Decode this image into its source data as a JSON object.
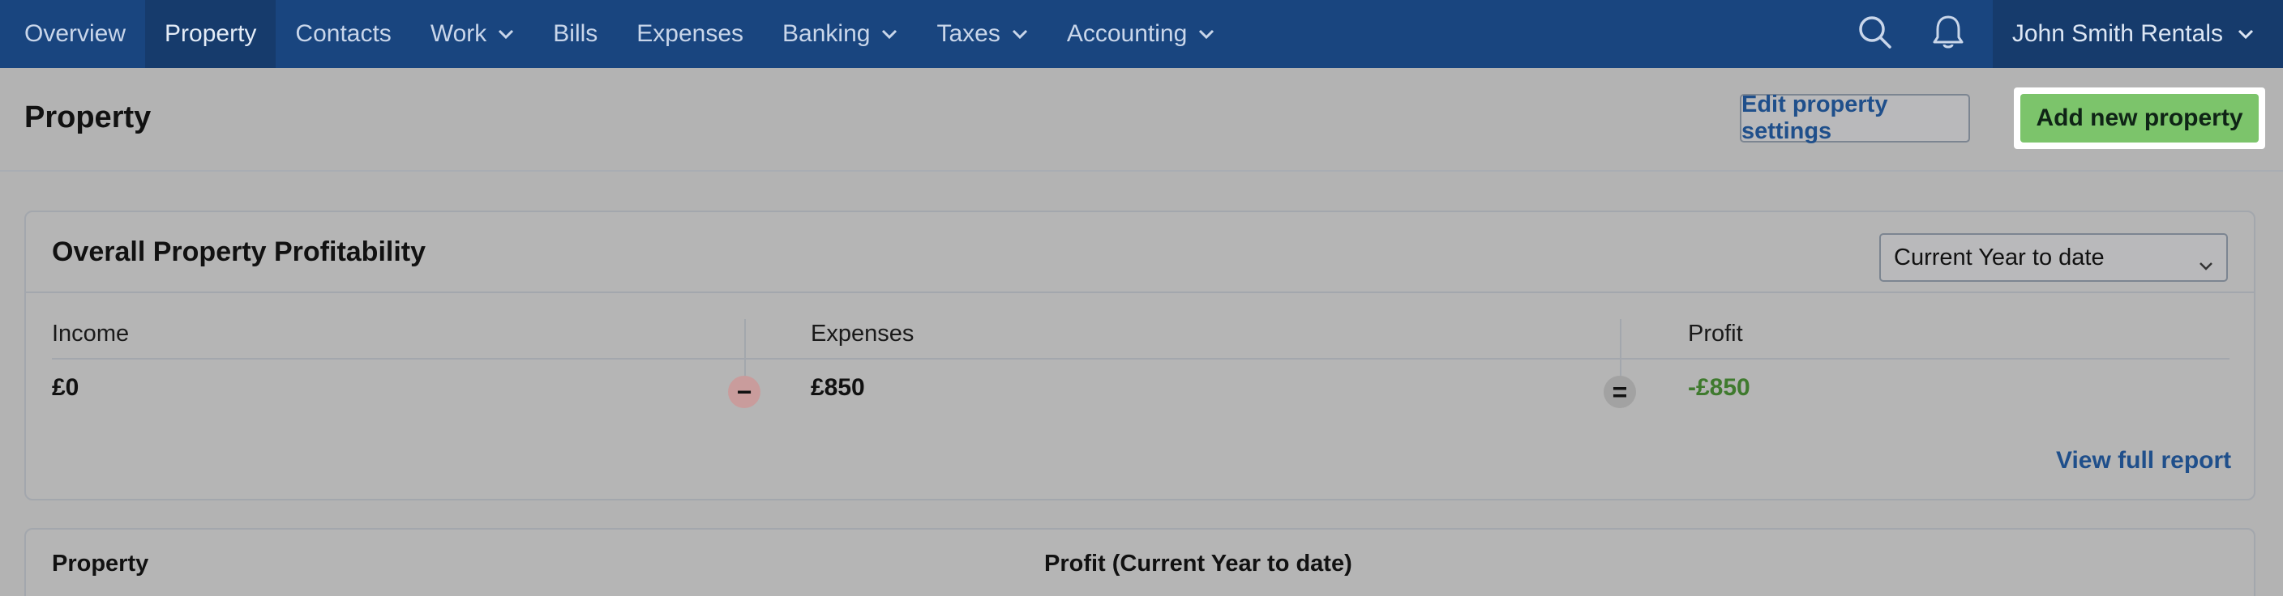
{
  "nav": {
    "items": [
      {
        "label": "Overview",
        "has_chevron": false,
        "active": false
      },
      {
        "label": "Property",
        "has_chevron": false,
        "active": true
      },
      {
        "label": "Contacts",
        "has_chevron": false,
        "active": false
      },
      {
        "label": "Work",
        "has_chevron": true,
        "active": false
      },
      {
        "label": "Bills",
        "has_chevron": false,
        "active": false
      },
      {
        "label": "Expenses",
        "has_chevron": false,
        "active": false
      },
      {
        "label": "Banking",
        "has_chevron": true,
        "active": false
      },
      {
        "label": "Taxes",
        "has_chevron": true,
        "active": false
      },
      {
        "label": "Accounting",
        "has_chevron": true,
        "active": false
      }
    ],
    "search_icon": "search-icon",
    "notifications_icon": "bell-icon",
    "account_name": "John Smith Rentals"
  },
  "page": {
    "title": "Property",
    "edit_button": "Edit property settings",
    "add_button": "Add new property"
  },
  "profitability": {
    "title": "Overall Property Profitability",
    "period_selected": "Current Year to date",
    "income_label": "Income",
    "income_value": "£0",
    "expenses_label": "Expenses",
    "expenses_value": "£850",
    "profit_label": "Profit",
    "profit_value": "-£850",
    "minus_symbol": "−",
    "equals_symbol": "=",
    "view_report": "View full report"
  },
  "table": {
    "col_property": "Property",
    "col_profit": "Profit (Current Year to date)"
  },
  "colors": {
    "nav_bg": "#19457f",
    "accent_link": "#1f4f8b",
    "add_button_bg": "#7cc46b",
    "profit_negative": "#3f7a2e"
  }
}
